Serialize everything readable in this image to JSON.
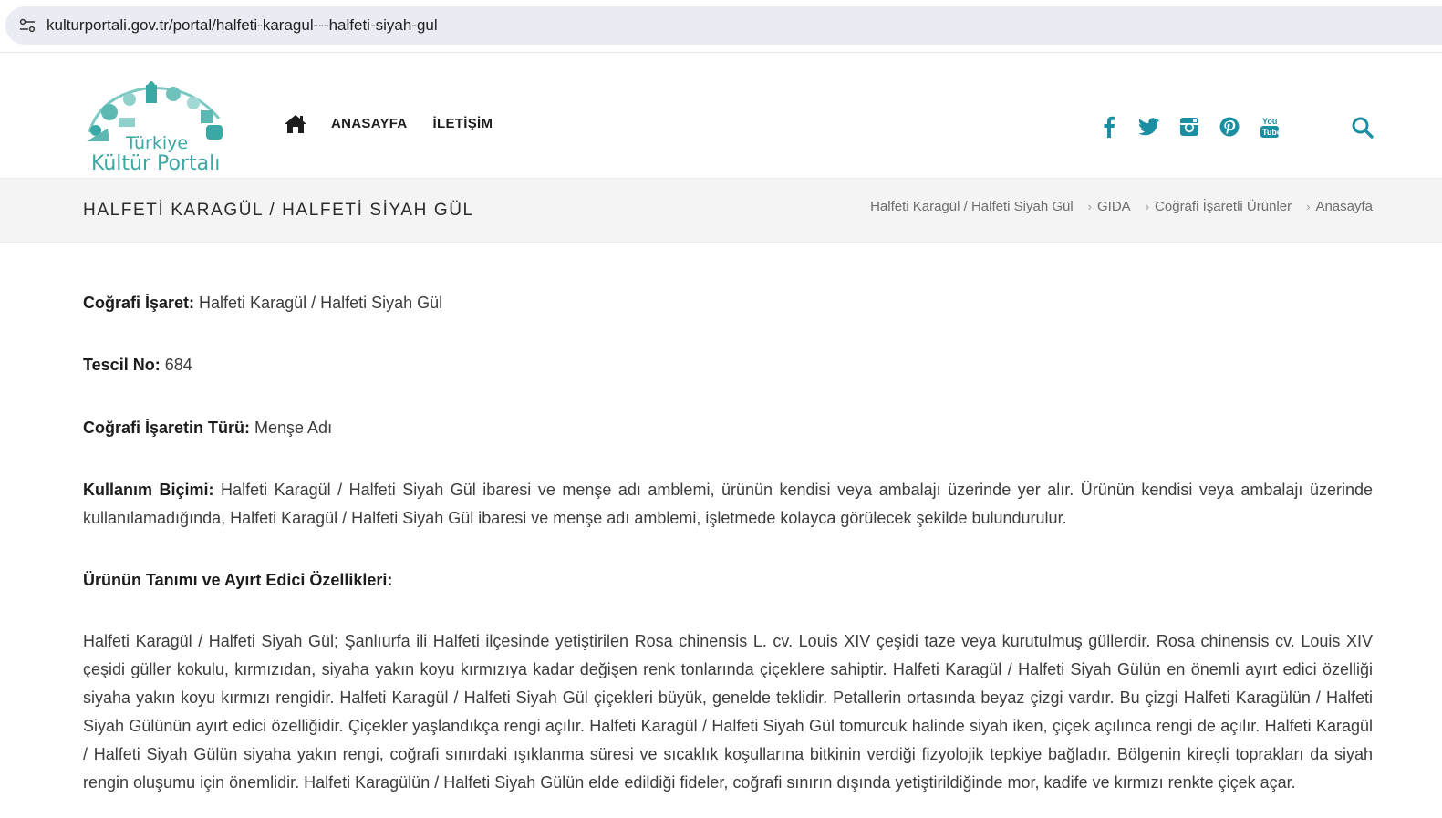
{
  "browser": {
    "url": "kulturportali.gov.tr/portal/halfeti-karagul---halfeti-siyah-gul"
  },
  "header": {
    "logo_line1": "Türkiye",
    "logo_line2": "Kültür Portalı",
    "nav": {
      "home_icon": "home-icon",
      "anasayfa": "ANASAYFA",
      "iletisim": "İLETİŞİM"
    },
    "social_icons": [
      "facebook-icon",
      "twitter-icon",
      "instagram-icon",
      "pinterest-icon",
      "youtube-icon"
    ],
    "search_icon": "search-icon",
    "accent_color": "#1b8fa1"
  },
  "title_band": {
    "title": "HALFETİ KARAGÜL / HALFETİ SİYAH GÜL",
    "breadcrumb": [
      "Halfeti Karagül / Halfeti Siyah Gül",
      "GIDA",
      "Coğrafi İşaretli Ürünler",
      "Anasayfa"
    ]
  },
  "content": {
    "cografi_isaret_label": "Coğrafi İşaret:",
    "cografi_isaret_value": " Halfeti Karagül / Halfeti Siyah Gül",
    "tescil_label": "Tescil No:",
    "tescil_value": " 684",
    "tur_label": "Coğrafi İşaretin Türü:",
    "tur_value": " Menşe Adı",
    "kullanim_label": "Kullanım Biçimi:",
    "kullanim_value": " Halfeti Karagül / Halfeti Siyah Gül ibaresi ve menşe adı amblemi, ürünün kendisi veya ambalajı üzerinde yer alır. Ürünün kendisi veya ambalajı üzerinde kullanılamadığında, Halfeti Karagül / Halfeti Siyah Gül ibaresi ve menşe adı amblemi, işletmede kolayca görülecek şekilde bulundurulur.",
    "tanim_heading": "Ürünün Tanımı ve Ayırt Edici Özellikleri:",
    "tanim_text": "Halfeti Karagül / Halfeti Siyah Gül; Şanlıurfa ili Halfeti ilçesinde yetiştirilen Rosa chinensis L. cv. Louis XIV çeşidi taze veya kurutulmuş güllerdir. Rosa chinensis cv. Louis XIV çeşidi güller kokulu, kırmızıdan, siyaha yakın koyu kırmızıya kadar değişen renk tonlarında çiçeklere sahiptir. Halfeti Karagül / Halfeti Siyah Gülün en önemli ayırt edici özelliği siyaha yakın koyu kırmızı rengidir. Halfeti Karagül / Halfeti Siyah Gül çiçekleri büyük, genelde teklidir. Petallerin ortasında beyaz çizgi vardır. Bu çizgi Halfeti Karagülün / Halfeti Siyah Gülünün ayırt edici özelliğidir. Çiçekler yaşlandıkça rengi açılır. Halfeti Karagül / Halfeti Siyah Gül tomurcuk halinde siyah iken, çiçek açılınca rengi de açılır. Halfeti Karagül / Halfeti Siyah Gülün siyaha yakın rengi, coğrafi sınırdaki ışıklanma süresi ve sıcaklık koşullarına bitkinin verdiği fizyolojik tepkiye bağladır. Bölgenin kireçli toprakları da siyah rengin oluşumu için önemlidir. Halfeti Karagülün / Halfeti Siyah Gülün elde edildiği fideler, coğrafi sınırın dışında yetiştirildiğinde mor, kadife ve kırmızı renkte çiçek açar."
  }
}
